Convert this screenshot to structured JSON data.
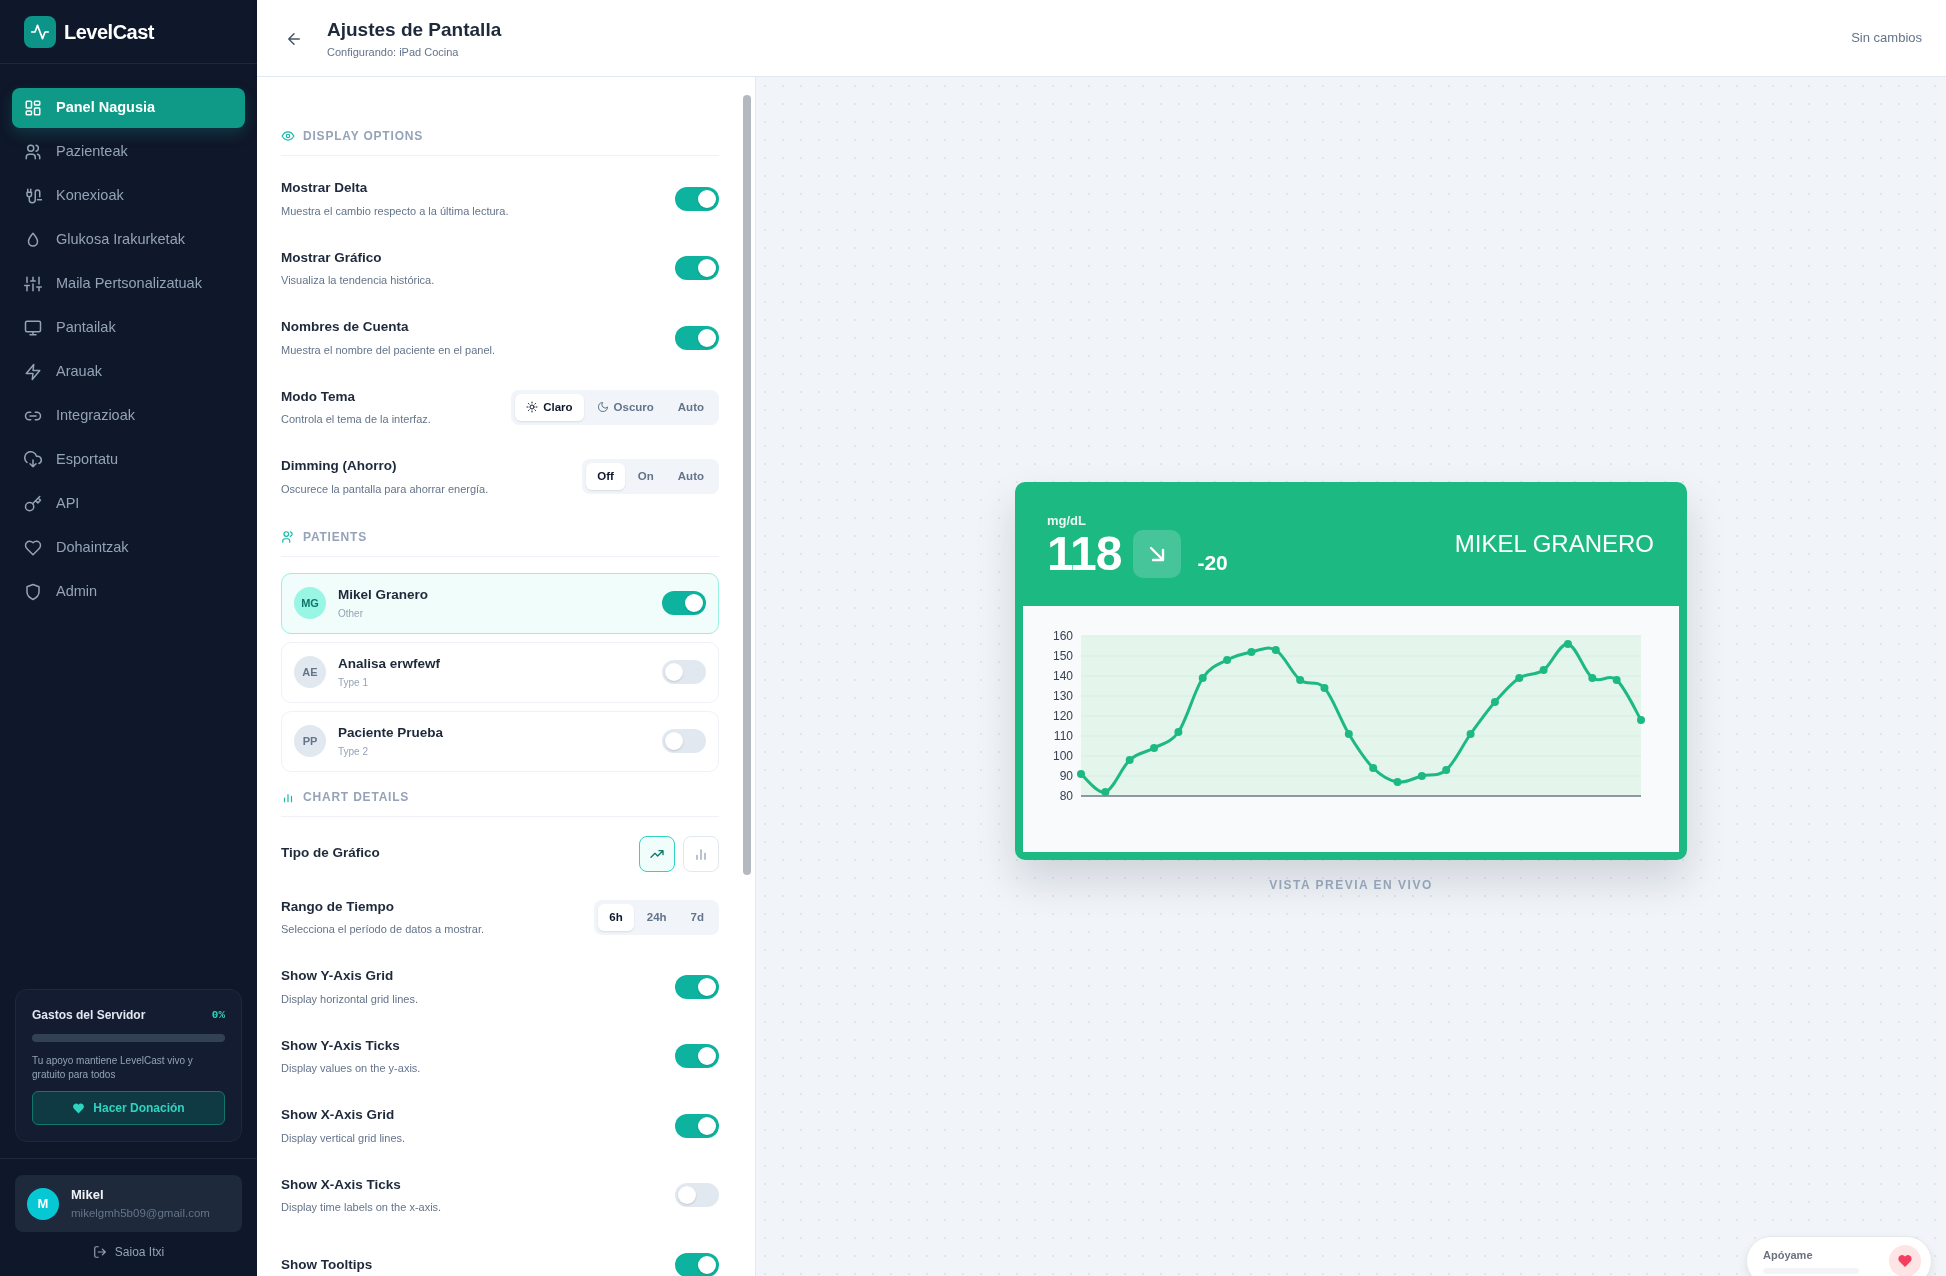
{
  "brand": {
    "name": "LevelCast"
  },
  "nav": [
    {
      "label": "Panel Nagusia",
      "selected": true
    },
    {
      "label": "Pazienteak",
      "selected": false
    },
    {
      "label": "Konexioak",
      "selected": false
    },
    {
      "label": "Glukosa Irakurketak",
      "selected": false
    },
    {
      "label": "Maila Pertsonalizatuak",
      "selected": false
    },
    {
      "label": "Pantailak",
      "selected": false
    },
    {
      "label": "Arauak",
      "selected": false
    },
    {
      "label": "Integrazioak",
      "selected": false
    },
    {
      "label": "Esportatu",
      "selected": false
    },
    {
      "label": "API",
      "selected": false
    },
    {
      "label": "Dohaintzak",
      "selected": false
    },
    {
      "label": "Admin",
      "selected": false
    }
  ],
  "server_costs": {
    "title": "Gastos del Servidor",
    "percent": "0%",
    "level": 0,
    "message": "Tu apoyo mantiene LevelCast vivo y gratuito para todos",
    "button": "Hacer Donación"
  },
  "user": {
    "initial": "M",
    "name": "Mikel",
    "email": "mikelgmh5b09@gmail.com"
  },
  "logout": "Saioa Itxi",
  "header": {
    "title": "Ajustes de Pantalla",
    "subtitle": "Configurando: iPad Cocina",
    "status": "Sin cambios"
  },
  "sections": [
    {
      "title": "DISPLAY OPTIONS",
      "rows": [
        {
          "kind": "toggle",
          "label": "Mostrar Delta",
          "description": "Muestra el cambio respecto a la última lectura.",
          "on": true
        },
        {
          "kind": "toggle",
          "label": "Mostrar Gráfico",
          "description": "Visualiza la tendencia histórica.",
          "on": true
        },
        {
          "kind": "toggle",
          "label": "Nombres de Cuenta",
          "description": "Muestra el nombre del paciente en el panel.",
          "on": true
        },
        {
          "kind": "segmented",
          "label": "Modo Tema",
          "description": "Controla el tema de la interfaz.",
          "options": [
            {
              "label": "Claro",
              "selected": true
            },
            {
              "label": "Oscuro",
              "selected": false
            },
            {
              "label": "Auto",
              "selected": false
            }
          ]
        },
        {
          "kind": "segmented",
          "label": "Dimming (Ahorro)",
          "description": "Oscurece la pantalla para ahorrar energía.",
          "options": [
            {
              "label": "Off",
              "selected": true
            },
            {
              "label": "On",
              "selected": false
            },
            {
              "label": "Auto",
              "selected": false
            }
          ]
        }
      ]
    },
    {
      "title": "PATIENTS",
      "patients": [
        {
          "initials": "MG",
          "name": "Mikel Granero",
          "type": "Other",
          "on": true
        },
        {
          "initials": "AE",
          "name": "Analisa erwfewf",
          "type": "Type 1",
          "on": false
        },
        {
          "initials": "PP",
          "name": "Paciente Prueba",
          "type": "Type 2",
          "on": false
        }
      ]
    },
    {
      "title": "CHART DETAILS",
      "rows": [
        {
          "kind": "icon-choice",
          "label": "Tipo de Gráfico",
          "options": [
            {
              "selected": true
            },
            {
              "selected": false
            }
          ]
        },
        {
          "kind": "segmented",
          "label": "Rango de Tiempo",
          "description": "Selecciona el período de datos a mostrar.",
          "options": [
            {
              "label": "6h",
              "selected": true
            },
            {
              "label": "24h",
              "selected": false
            },
            {
              "label": "7d",
              "selected": false
            }
          ]
        },
        {
          "kind": "toggle",
          "label": "Show Y-Axis Grid",
          "description": "Display horizontal grid lines.",
          "on": true
        },
        {
          "kind": "toggle",
          "label": "Show Y-Axis Ticks",
          "description": "Display values on the y-axis.",
          "on": true
        },
        {
          "kind": "toggle",
          "label": "Show X-Axis Grid",
          "description": "Display vertical grid lines.",
          "on": true
        },
        {
          "kind": "toggle",
          "label": "Show X-Axis Ticks",
          "description": "Display time labels on the x-axis.",
          "on": false
        },
        {
          "kind": "toggle",
          "label": "Show Tooltips",
          "on": true
        }
      ]
    }
  ],
  "preview": {
    "unit": "mg/dL",
    "value": "118",
    "delta": "-20",
    "name": "MIKEL GRANERO",
    "chart_data": {
      "type": "line",
      "grid": true,
      "marker": true,
      "values": [
        91,
        82,
        98,
        104,
        112,
        139,
        148,
        152,
        153,
        138,
        134,
        111,
        94,
        87,
        90,
        93,
        111,
        127,
        139,
        143,
        156,
        139,
        138,
        118
      ],
      "ylim": [
        80,
        160
      ],
      "yticks": [
        80,
        90,
        100,
        110,
        120,
        130,
        140,
        150,
        160
      ]
    },
    "caption": "VISTA PREVIA EN VIVO"
  },
  "support_widget": {
    "label": "Apóyame"
  }
}
